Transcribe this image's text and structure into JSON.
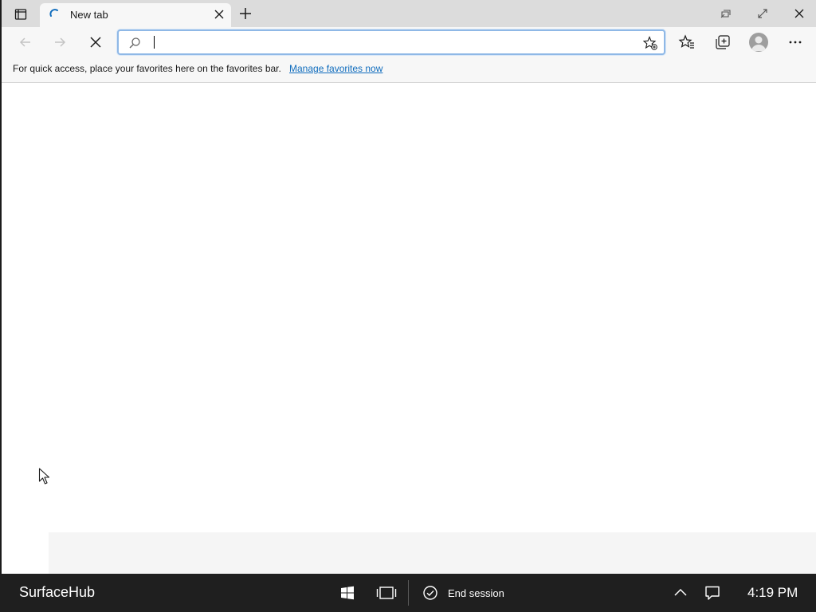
{
  "browser": {
    "tab": {
      "title": "New tab"
    },
    "addressbar": {
      "value": "",
      "placeholder": ""
    },
    "favorites_bar": {
      "message": "For quick access, place your favorites here on the favorites bar.",
      "link": "Manage favorites now"
    }
  },
  "icons": [
    "tab-actions-icon",
    "loading-spinner-icon",
    "close-icon",
    "plus-icon",
    "restore-icon",
    "expand-icon",
    "close-window-icon",
    "back-arrow-icon",
    "forward-arrow-icon",
    "stop-icon",
    "search-icon",
    "add-favorite-icon",
    "favorites-icon",
    "collections-icon",
    "profile-icon",
    "more-icon",
    "windows-start-icon",
    "task-view-icon",
    "checkmark-circle-icon",
    "chevron-up-icon",
    "notification-icon",
    "mouse-cursor-icon"
  ],
  "taskbar": {
    "brand": "SurfaceHub",
    "end_session": "End session",
    "time": "4:19 PM"
  },
  "colors": {
    "accent": "#0f6cbd",
    "taskbar_bg": "#1f1f1f",
    "titlebar_bg": "#dcdcdc",
    "toolbar_bg": "#f7f7f7",
    "focus_border": "#8fb8e6"
  }
}
